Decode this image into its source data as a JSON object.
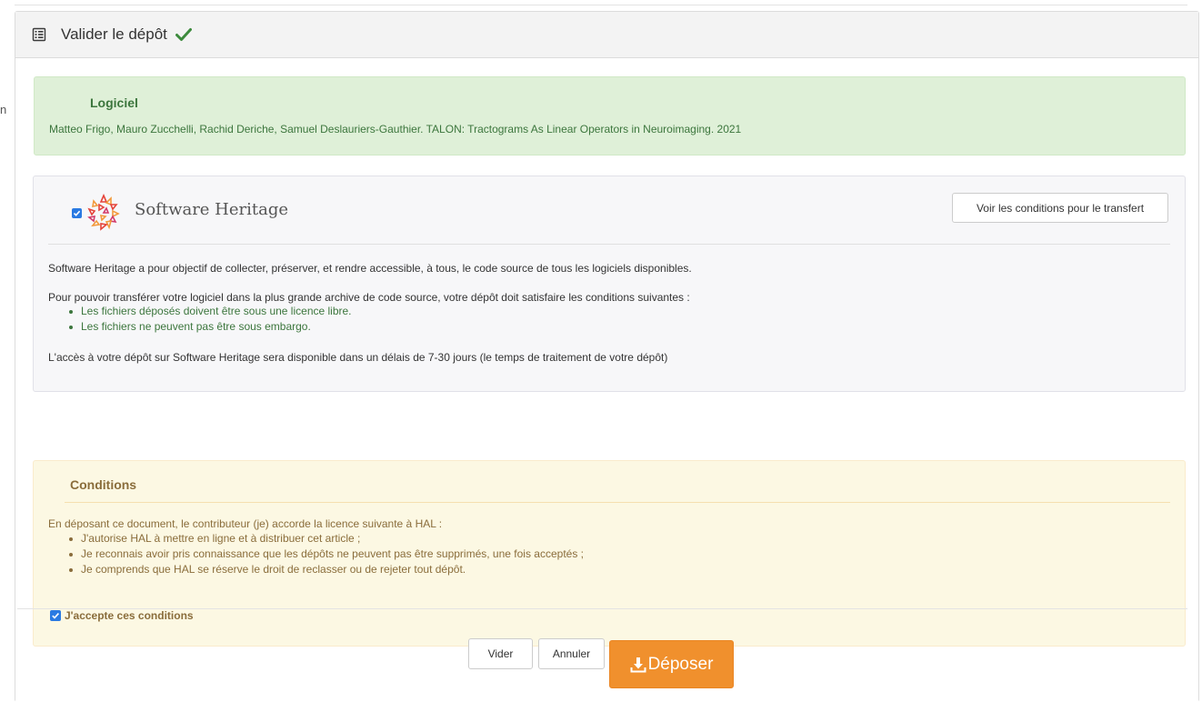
{
  "header": {
    "title": "Valider le dépôt",
    "icon": "list-alt-icon",
    "status_icon": "check-icon",
    "status_color": "#3c8a3c"
  },
  "software_alert": {
    "title": "Logiciel",
    "citation": "Matteo Frigo, Mauro Zucchelli, Rachid Deriche, Samuel Deslauriers-Gauthier. TALON: Tractograms As Linear Operators in Neuroimaging. 2021",
    "color": "#3c763d"
  },
  "swh": {
    "checkbox_checked": true,
    "logo_name": "Software Heritage",
    "conditions_button": "Voir les conditions pour le transfert",
    "intro": "Software Heritage a pour objectif de collecter, préserver, et rendre accessible, à tous, le code source de tous les logiciels disponibles.",
    "requirements_intro": "Pour pouvoir transférer votre logiciel dans la plus grande archive de code source, votre dépôt doit satisfaire les conditions suivantes :",
    "requirements": [
      "Les fichiers déposés doivent être sous une licence libre.",
      "Les fichiers ne peuvent pas être sous embargo."
    ],
    "access_note": "L'accès à votre dépôt sur Software Heritage sera disponible dans un délais de 7-30 jours (le temps de traitement de votre dépôt)"
  },
  "conditions": {
    "title": "Conditions",
    "intro": "En déposant ce document, le contributeur (je) accorde la licence suivante à HAL :",
    "items": [
      "J'autorise HAL à mettre en ligne et à distribuer cet article ;",
      "Je reconnais avoir pris connaissance que les dépôts ne peuvent pas être supprimés, une fois acceptés ;",
      "Je comprends que HAL se réserve le droit de reclasser ou de rejeter tout dépôt."
    ],
    "accept_label": "J'accepte ces conditions",
    "accept_checked": true,
    "color": "#8a6d3b"
  },
  "actions": {
    "clear": "Vider",
    "cancel": "Annuler",
    "submit": "Déposer",
    "submit_color": "#f0902d",
    "submit_icon": "download-icon"
  },
  "stray": "n"
}
